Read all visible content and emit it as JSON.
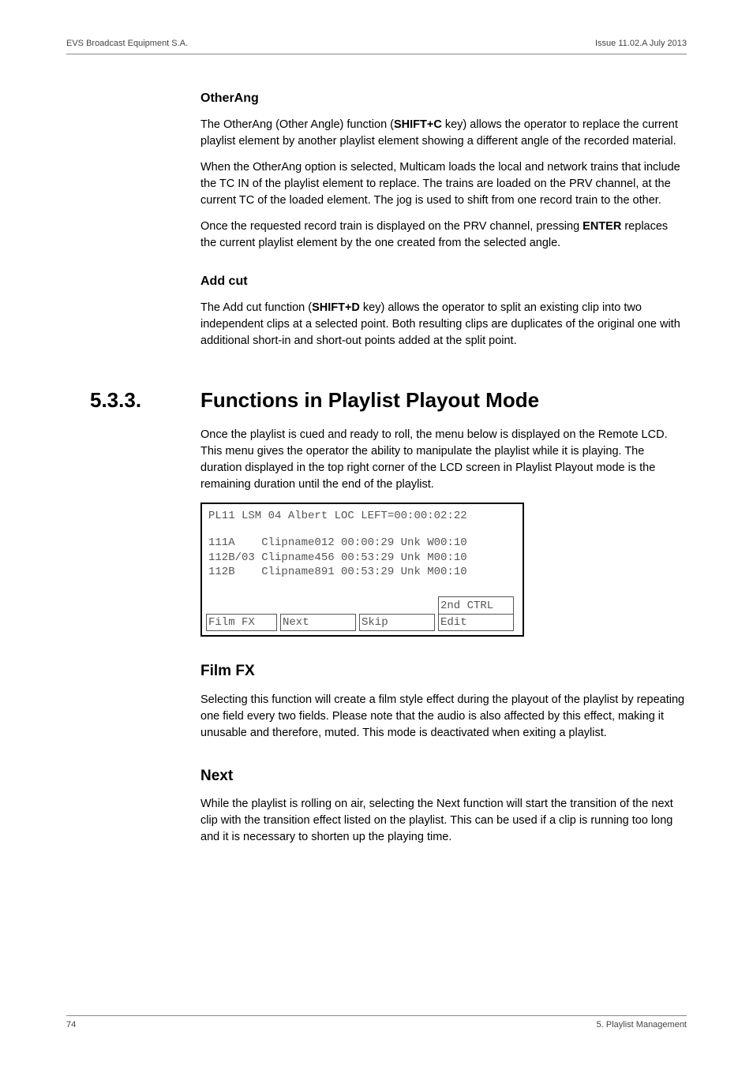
{
  "header": {
    "left": "EVS Broadcast Equipment S.A.",
    "right": "Issue 11.02.A  July 2013"
  },
  "otherang": {
    "title": "OtherAng",
    "p1a": "The OtherAng (Other Angle) function (",
    "p1key": "SHIFT+C",
    "p1b": " key) allows the operator to replace the current playlist element by another playlist element showing a different angle of the recorded material.",
    "p2": "When the OtherAng option is selected, Multicam loads the local and network trains that include the TC IN of the playlist element to replace. The trains are loaded on the PRV channel, at the current TC of the loaded element. The jog is used to shift from one record train to the other.",
    "p3a": "Once the requested record train is displayed on the PRV channel, pressing ",
    "p3key": "ENTER",
    "p3b": " replaces the current playlist element by the one created from the selected angle."
  },
  "addcut": {
    "title": "Add cut",
    "p1a": "The Add cut function (",
    "p1key": "SHIFT+D",
    "p1b": " key) allows the operator to split an existing clip into two independent clips at a selected point. Both resulting clips are duplicates of the original one with additional short-in and short-out points added at the split point."
  },
  "section": {
    "num": "5.3.3.",
    "title": "Functions in Playlist Playout Mode",
    "intro": "Once the playlist is cued and ready to roll, the menu below is displayed on the Remote LCD. This menu gives the operator the ability to manipulate the playlist while it is playing. The duration displayed in the top right corner of the LCD screen in Playlist Playout mode is the remaining duration until the end of the playlist."
  },
  "lcd": {
    "header": "PL11 LSM 04 Albert LOC LEFT=00:00:02:22",
    "line1": "111A    Clipname012 00:00:29 Unk W00:10",
    "line2": "112B/03 Clipname456 00:53:29 Unk M00:10",
    "line3": "112B    Clipname891 00:53:29 Unk M00:10",
    "box1": "Film FX",
    "box2": "Next",
    "box3": "Skip",
    "box4_top": "2nd CTRL",
    "box4": "Edit"
  },
  "filmfx": {
    "title": "Film FX",
    "p": "Selecting this function will create a film style effect during the playout of the playlist by repeating one field every two fields. Please note that the audio is also affected by this effect, making it unusable and therefore, muted. This mode is deactivated when exiting a playlist."
  },
  "next": {
    "title": "Next",
    "p": "While the playlist is rolling on air, selecting the Next function will start the transition of the next clip with the transition effect listed on the playlist. This can be used if a clip is running too long and it is necessary to shorten up the playing time."
  },
  "footer": {
    "left": "74",
    "right": "5. Playlist Management"
  }
}
